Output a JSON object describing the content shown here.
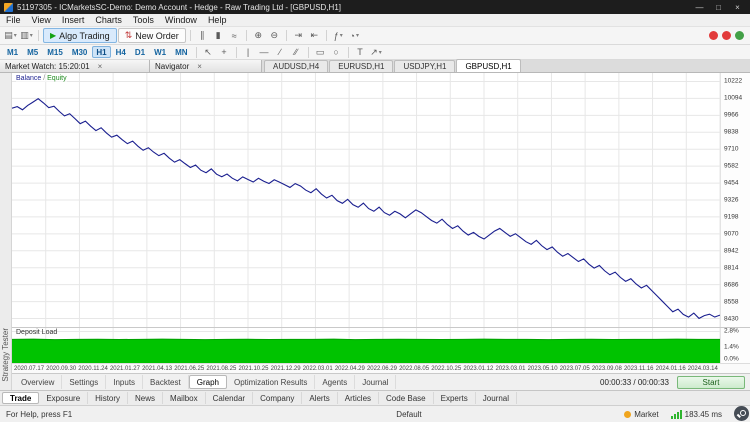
{
  "title_bar": {
    "title": "51197305 - ICMarketsSC-Demo: Demo Account - Hedge - Raw Trading Ltd - [GBPUSD,H1]"
  },
  "icons": {
    "minimize": "—",
    "restore": "□",
    "close": "×",
    "dropdown": "▾",
    "new_chart": "▤",
    "profiles": "▥",
    "play": "▶",
    "new_order": "⇅",
    "bars": "∥",
    "candles": "▮",
    "line_chart": "≈",
    "zoom_in": "⊕",
    "zoom_out": "⊖",
    "autoscroll": "⇥",
    "shift": "⇤",
    "indicators": "ƒ",
    "clock": "◔",
    "cursor": "↖",
    "crosshair": "+",
    "vline": "|",
    "hline": "—",
    "trend": "∕",
    "channel": "∕∕",
    "rect": "▭",
    "ellipse": "○",
    "text_tool": "T",
    "arrow_tool": "↗"
  },
  "menu": {
    "items": [
      "File",
      "View",
      "Insert",
      "Charts",
      "Tools",
      "Window",
      "Help"
    ]
  },
  "toolbar1": {
    "algo_trading": "Algo Trading",
    "new_order": "New Order"
  },
  "timeframes": {
    "items": [
      "M1",
      "M5",
      "M15",
      "M30",
      "H1",
      "H4",
      "D1",
      "W1",
      "MN"
    ],
    "active": "H1"
  },
  "panels": {
    "market_watch_title": "Market Watch: 15:20:01",
    "navigator_title": "Navigator"
  },
  "chart_tabs": {
    "items": [
      "AUDUSD,H4",
      "EURUSD,H1",
      "USDJPY,H1",
      "GBPUSD,H1"
    ],
    "active": "GBPUSD,H1"
  },
  "tester": {
    "side_label": "Strategy Tester",
    "legend": {
      "balance": "Balance",
      "separator": " / ",
      "equity": "Equity"
    },
    "deposit_label": "Deposit Load",
    "tabs": [
      "Overview",
      "Settings",
      "Inputs",
      "Backtest",
      "Graph",
      "Optimization Results",
      "Agents",
      "Journal"
    ],
    "active_tab": "Graph",
    "elapsed": "00:00:33 / 00:00:33",
    "start_label": "Start"
  },
  "toolbox": {
    "tabs": [
      "Trade",
      "Exposure",
      "History",
      "News",
      "Mailbox",
      "Calendar",
      "Company",
      "Alerts",
      "Articles",
      "Code Base",
      "Experts",
      "Journal"
    ],
    "active": "Trade"
  },
  "status_bar": {
    "help": "For Help, press F1",
    "profile": "Default",
    "market_label": "Market",
    "ping": "183.45 ms"
  },
  "colors": {
    "balance_line": "#1a1f8f",
    "equity": "#1e8c1e",
    "deposit_fill": "#00c300",
    "deposit_stroke": "#00a000",
    "grid": "#e7e7e7",
    "timeframe_active_bg": "#cfe4f7",
    "market_dot": "#f0a51e",
    "signal_bars": "#2eb52e",
    "badge_red": "#e23b3b",
    "badge_green": "#43a047"
  },
  "chart_data": [
    {
      "type": "line",
      "title": "Balance / Equity",
      "legend": [
        "Balance",
        "Equity"
      ],
      "legend_position": "top-left",
      "grid": true,
      "ylim": [
        8366,
        10286
      ],
      "y_ticks": [
        10222,
        10094,
        9966,
        9838,
        9710,
        9582,
        9454,
        9326,
        9198,
        9070,
        8942,
        8814,
        8686,
        8558,
        8430
      ],
      "x_tick_labels": [
        "2020.07.17",
        "2020.09.30",
        "2020.11.24",
        "2021.01.27",
        "2021.04.13",
        "2021.06.25",
        "2021.08.25",
        "2021.10.25",
        "2021.12.29",
        "2022.03.01",
        "2022.04.29",
        "2022.06.29",
        "2022.08.05",
        "2022.10.25",
        "2023.01.12",
        "2023.03.01",
        "2023.05.10",
        "2023.07.05",
        "2023.09.08",
        "2023.11.16",
        "2024.01.16",
        "2024.03.14"
      ],
      "series": [
        {
          "name": "Balance",
          "color": "#1a1f8f",
          "values": [
            10020,
            10032,
            10008,
            10041,
            10066,
            10092,
            10060,
            10024,
            10035,
            9996,
            9962,
            9978,
            9941,
            9903,
            9922,
            9884,
            9851,
            9872,
            9833,
            9801,
            9816,
            9782,
            9752,
            9771,
            9733,
            9702,
            9721,
            9688,
            9661,
            9679,
            9642,
            9612,
            9631,
            9601,
            9572,
            9590,
            9551,
            9532,
            9561,
            9521,
            9502,
            9522,
            9491,
            9471,
            9501,
            9481,
            9462,
            9490,
            9468,
            9451,
            9479,
            9461,
            9441,
            9421,
            9450,
            9432,
            9401,
            9381,
            9411,
            9371,
            9341,
            9362,
            9321,
            9301,
            9331,
            9291,
            9271,
            9302,
            9261,
            9241,
            9272,
            9231,
            9211,
            9241,
            9221,
            9191,
            9222,
            9251,
            9231,
            9201,
            9171,
            9151,
            9181,
            9141,
            9111,
            9131,
            9091,
            9061,
            9081,
            9051,
            9031,
            9061,
            9091,
            9111,
            9081,
            9051,
            9071,
            9041,
            9011,
            8991,
            9021,
            8981,
            8951,
            8971,
            8931,
            8901,
            8921,
            8891,
            8861,
            8881,
            8841,
            8811,
            8831,
            8791,
            8761,
            8781,
            8741,
            8711,
            8731,
            8691,
            8661,
            8681,
            8641,
            8601,
            8561,
            8521,
            8481,
            8501,
            8461,
            8441,
            8471,
            8431,
            8452,
            8463,
            8441,
            8456
          ]
        }
      ]
    },
    {
      "type": "area",
      "title": "Deposit Load",
      "ylim": [
        0,
        3.11
      ],
      "y_ticks": [
        "2.8%",
        "1.4%",
        "0.0%"
      ],
      "y_tick_values": [
        2.8,
        1.4,
        0.0
      ],
      "series": [
        {
          "name": "Deposit Load",
          "color": "#00c300",
          "values": [
            2.1,
            2.12,
            2.08,
            2.1,
            2.11,
            2.09,
            2.1,
            2.12,
            2.1,
            2.08,
            2.1,
            2.11,
            2.09,
            2.1,
            2.1,
            2.12,
            2.08,
            2.1,
            2.11,
            2.1,
            2.09,
            2.1,
            2.12,
            2.1,
            2.1,
            2.08,
            2.1,
            2.11,
            2.09,
            2.1,
            2.1,
            2.12,
            2.1,
            2.1
          ]
        }
      ]
    }
  ]
}
